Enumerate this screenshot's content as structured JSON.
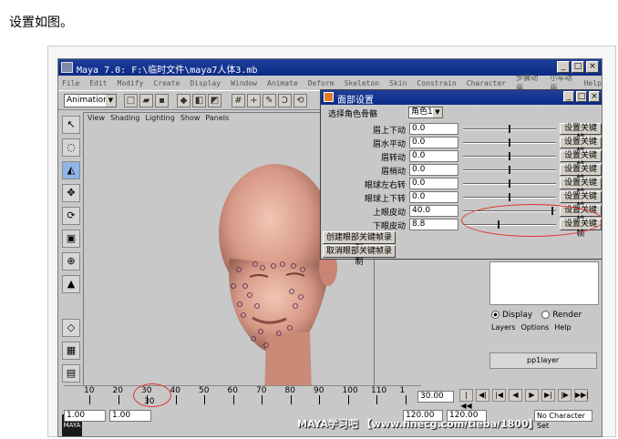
{
  "caption": "设置如图。",
  "window": {
    "title": "Maya 7.0: F:\\临时文件\\maya7人体3.mb",
    "controls": [
      "_",
      "□",
      "×"
    ]
  },
  "menubar": [
    "File",
    "Edit",
    "Modify",
    "Create",
    "Display",
    "Window",
    "Animate",
    "Deform",
    "Skeleton",
    "Skin",
    "Constrain",
    "Character",
    "步骤动画",
    "小车动画",
    "Help"
  ],
  "shelf": {
    "mode": "Animation"
  },
  "viewport": {
    "menu": [
      "View",
      "Shading",
      "Lighting",
      "Show",
      "Panels"
    ]
  },
  "dialog": {
    "title": "面部设置",
    "select_label": "选择角色骨骼",
    "select_value": "角色1",
    "rows": [
      {
        "label": "眉上下动",
        "value": "0.0",
        "slider": 0.5,
        "button": "设置关键帧"
      },
      {
        "label": "眉水平动",
        "value": "0.0",
        "slider": 0.5,
        "button": "设置关键帧"
      },
      {
        "label": "眉转动",
        "value": "0.0",
        "slider": 0.5,
        "button": "设置关键帧"
      },
      {
        "label": "眉梢动",
        "value": "0.0",
        "slider": 0.5,
        "button": "设置关键帧"
      },
      {
        "label": "眼球左右转",
        "value": "0.0",
        "slider": 0.5,
        "button": "设置关键帧"
      },
      {
        "label": "眼球上下转",
        "value": "0.0",
        "slider": 0.5,
        "button": "设置关键帧"
      },
      {
        "label": "上眼皮动",
        "value": "40.0",
        "slider": 0.97,
        "button": "设置关键帧"
      },
      {
        "label": "下眼皮动",
        "value": "8.8",
        "slider": 0.38,
        "button": "设置关键帧"
      }
    ],
    "create_button": "创建眼部关键帧录制",
    "cancel_button": "取消眼部关键帧录制"
  },
  "layers": {
    "display": "Display",
    "render": "Render",
    "menu": [
      "Layers",
      "Options",
      "Help"
    ],
    "layer_name": "pp1layer"
  },
  "timeline": {
    "ticks": [
      "10",
      "20",
      "30",
      "40",
      "50",
      "60",
      "70",
      "80",
      "90",
      "100",
      "110",
      "1"
    ],
    "current_marker": "30",
    "current_frame": "30.00"
  },
  "range": {
    "start": "1.00",
    "start2": "1.00",
    "end": "120.00",
    "end2": "120.00",
    "character_set": "No Character Set"
  },
  "watermark": "MAYA学习吧 【www.finecg.com/tieba/1800】",
  "colors": {
    "title_blue": "#0a2a86",
    "annotation_red": "#e0302a"
  }
}
